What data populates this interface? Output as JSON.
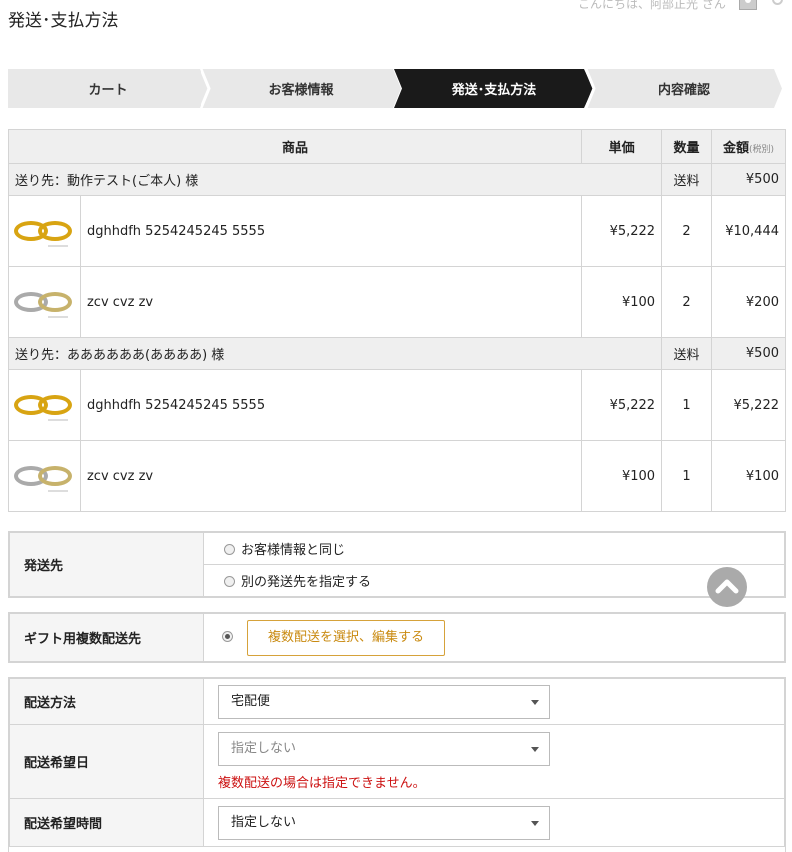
{
  "page": {
    "title": "発送･支払方法"
  },
  "header": {
    "greeting": "こんにちは、阿部正光 さん"
  },
  "steps": [
    "カート",
    "お客様情報",
    "発送･支払方法",
    "内容確認"
  ],
  "table": {
    "headers": {
      "product": "商品",
      "unit_price": "単価",
      "qty": "数量",
      "amount": "金額",
      "tax_note": "(税別)"
    },
    "groups": [
      {
        "ship_to": "送り先：動作テスト(ご本人) 様",
        "shipping_label": "送料",
        "shipping_fee": "¥500",
        "items": [
          {
            "name": "dghhdfh 5254245245 5555",
            "price": "¥5,222",
            "qty": "2",
            "amount": "¥10,444",
            "ring": "gold"
          },
          {
            "name": "zcv cvz zv",
            "price": "¥100",
            "qty": "2",
            "amount": "¥200",
            "ring": "silver"
          }
        ]
      },
      {
        "ship_to": "送り先：ああああああ(ああああ) 様",
        "shipping_label": "送料",
        "shipping_fee": "¥500",
        "items": [
          {
            "name": "dghhdfh 5254245245 5555",
            "price": "¥5,222",
            "qty": "1",
            "amount": "¥5,222",
            "ring": "gold"
          },
          {
            "name": "zcv cvz zv",
            "price": "¥100",
            "qty": "1",
            "amount": "¥100",
            "ring": "silver"
          }
        ]
      }
    ]
  },
  "destination": {
    "label": "発送先",
    "option_same": "お客様情報と同じ",
    "option_other": "別の発送先を指定する"
  },
  "gift": {
    "label": "ギフト用複数配送先",
    "button": "複数配送を選択、編集する"
  },
  "delivery": {
    "method_label": "配送方法",
    "method_value": "宅配便",
    "date_label": "配送希望日",
    "date_value": "指定しない",
    "date_error": "複数配送の場合は指定できません。",
    "time_label": "配送希望時間",
    "time_value": "指定しない"
  },
  "colors": {
    "active_step": "#1a1a1a",
    "step": "#e8e8e8",
    "accent": "#d6a23a",
    "error": "#cc1111"
  }
}
